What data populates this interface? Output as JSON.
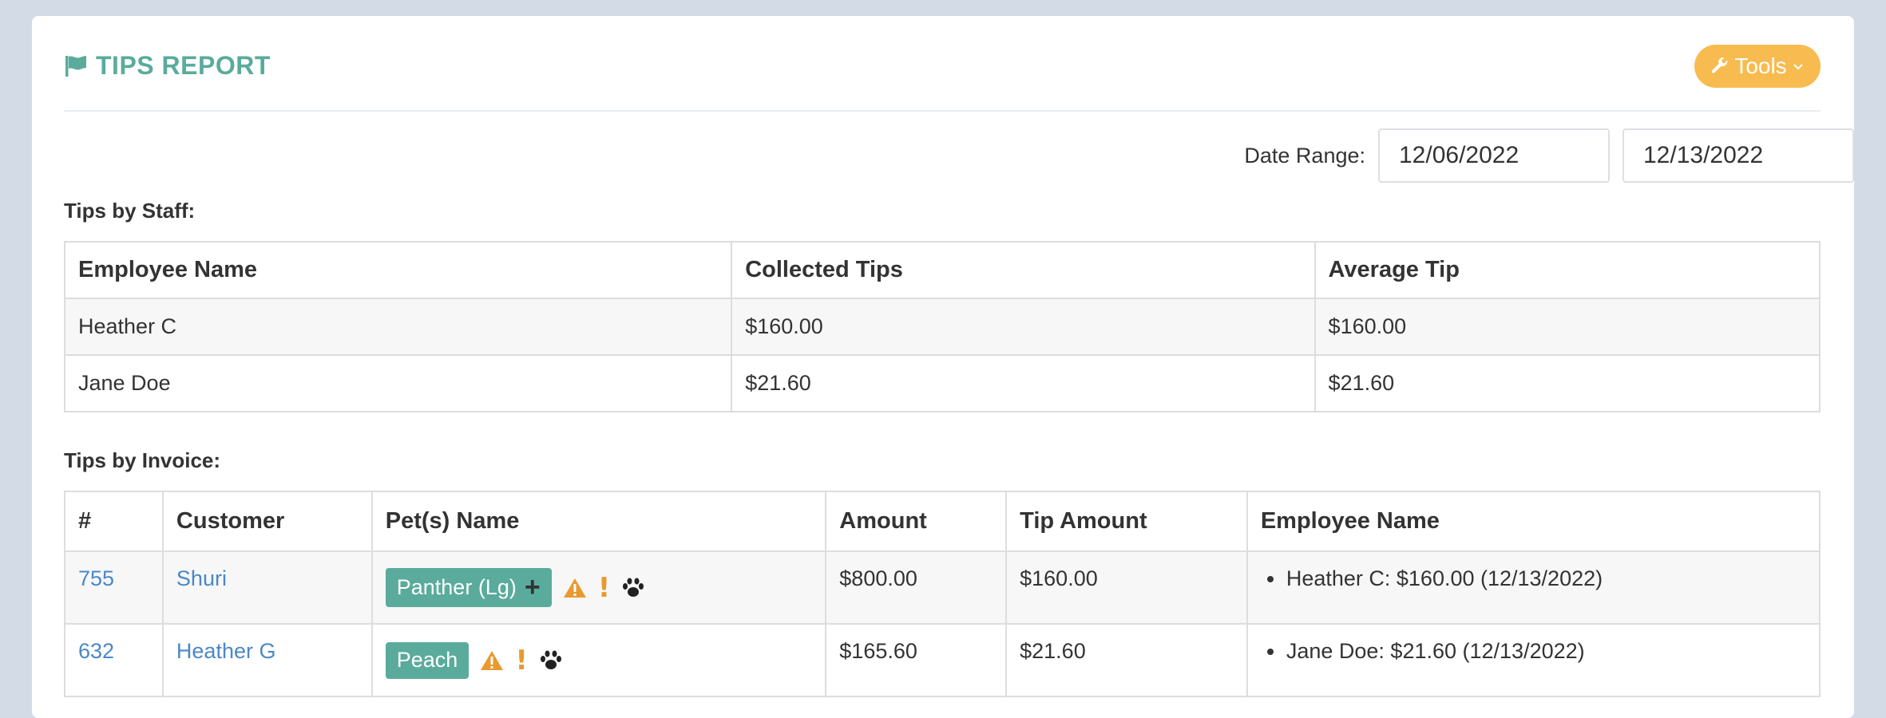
{
  "header": {
    "title": "TIPS REPORT",
    "tools_label": "Tools"
  },
  "date_range": {
    "label": "Date Range:",
    "start": "12/06/2022",
    "end": "12/13/2022"
  },
  "staff_section": {
    "label": "Tips by Staff:",
    "columns": [
      "Employee Name",
      "Collected Tips",
      "Average Tip"
    ],
    "rows": [
      {
        "name": "Heather C",
        "collected": "$160.00",
        "average": "$160.00"
      },
      {
        "name": "Jane Doe",
        "collected": "$21.60",
        "average": "$21.60"
      }
    ]
  },
  "invoice_section": {
    "label": "Tips by Invoice:",
    "columns": [
      "#",
      "Customer",
      "Pet(s) Name",
      "Amount",
      "Tip Amount",
      "Employee Name"
    ],
    "rows": [
      {
        "number": "755",
        "customer": "Shuri",
        "pet": "Panther (Lg)",
        "show_plus": true,
        "amount": "$800.00",
        "tip": "$160.00",
        "employee": "Heather C: $160.00 (12/13/2022)"
      },
      {
        "number": "632",
        "customer": "Heather G",
        "pet": "Peach",
        "show_plus": false,
        "amount": "$165.60",
        "tip": "$21.60",
        "employee": "Jane Doe: $21.60 (12/13/2022)"
      }
    ]
  },
  "colors": {
    "accent_teal": "#5aab9c",
    "tools_orange": "#f7bb4f",
    "link_blue": "#4a88c6",
    "warning_orange": "#e89a2f"
  },
  "icons": [
    "flag-icon",
    "wrench-icon",
    "chevron-down-icon",
    "plus-icon",
    "warning-icon",
    "exclamation-icon",
    "paw-icon"
  ]
}
